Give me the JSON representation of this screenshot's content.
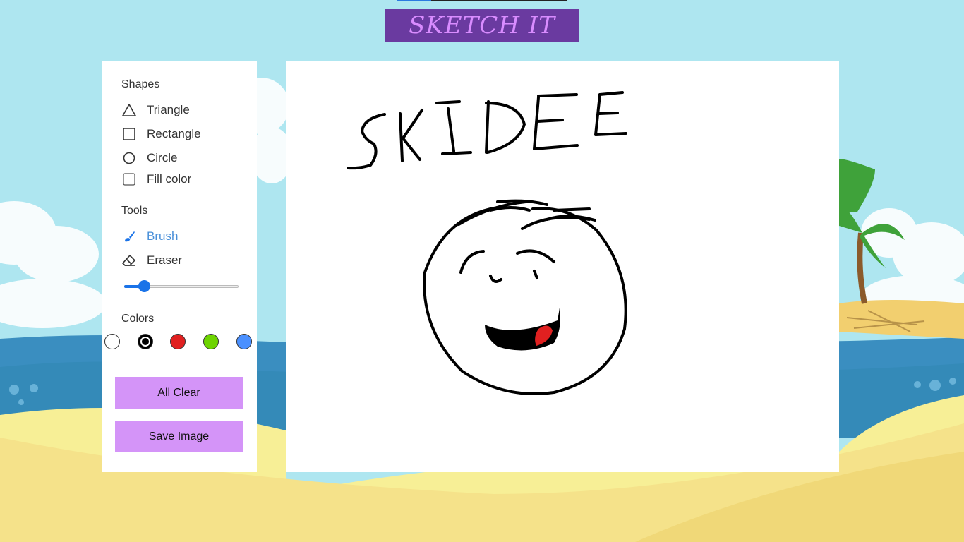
{
  "app": {
    "title": "SKETCH IT"
  },
  "panel": {
    "shapes_title": "Shapes",
    "shapes": [
      {
        "label": "Triangle",
        "icon": "triangle-icon"
      },
      {
        "label": "Rectangle",
        "icon": "square-icon"
      },
      {
        "label": "Circle",
        "icon": "circle-icon"
      }
    ],
    "fill_color_label": "Fill color",
    "fill_color_checked": false,
    "tools_title": "Tools",
    "tools": [
      {
        "label": "Brush",
        "icon": "brush-icon",
        "active": true
      },
      {
        "label": "Eraser",
        "icon": "eraser-icon",
        "active": false
      }
    ],
    "brush_size": 5,
    "colors_title": "Colors",
    "colors": [
      {
        "hex": "#ffffff",
        "selected": false
      },
      {
        "hex": "#000000",
        "selected": true
      },
      {
        "hex": "#e02020",
        "selected": false
      },
      {
        "hex": "#6dd400",
        "selected": false
      },
      {
        "hex": "#4a90ff",
        "selected": false
      }
    ],
    "clear_label": "All Clear",
    "save_label": "Save Image"
  },
  "canvas": {
    "drawn_text": "SKIDEE"
  },
  "colors": {
    "title_bg": "#6a3aa0",
    "title_text": "#d98cff",
    "button_bg": "#d494f8",
    "accent": "#1a73e8"
  }
}
